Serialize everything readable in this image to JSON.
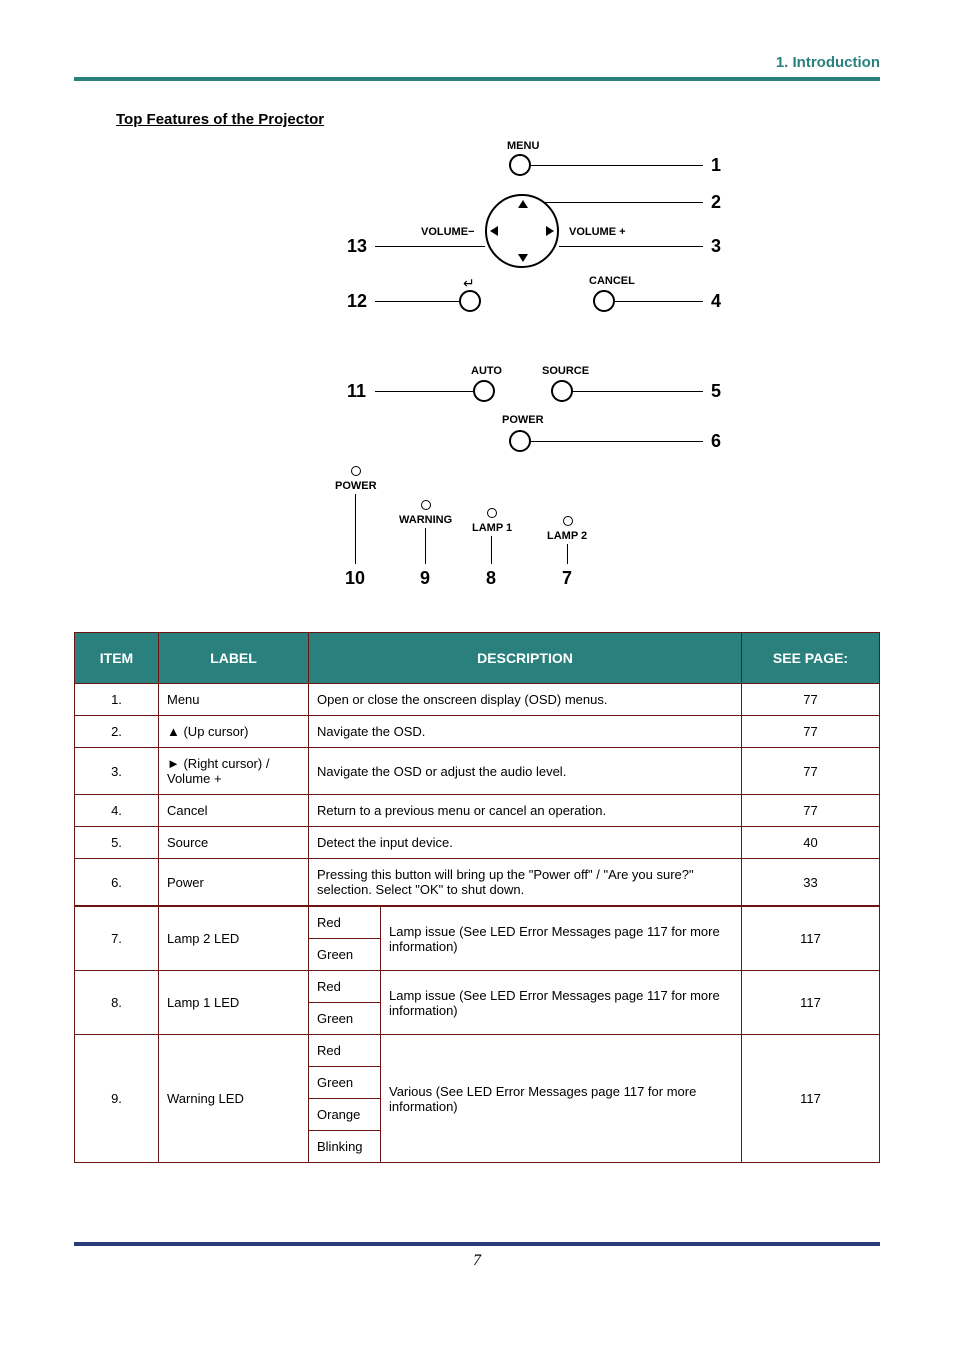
{
  "header": {
    "title": "1. Introduction"
  },
  "section_title": "Top Features of the Projector",
  "diagram": {
    "labels": {
      "menu": "MENU",
      "volume_minus": "VOLUME−",
      "volume_plus": "VOLUME +",
      "cancel": "CANCEL",
      "auto": "AUTO",
      "source": "SOURCE",
      "power_btn": "POWER",
      "power_led": "POWER",
      "warning": "WARNING",
      "lamp1": "LAMP 1",
      "lamp2": "LAMP 2"
    },
    "numbers": {
      "n1": "1",
      "n2": "2",
      "n3": "3",
      "n4": "4",
      "n5": "5",
      "n6": "6",
      "n7": "7",
      "n8": "8",
      "n9": "9",
      "n10": "10",
      "n11": "11",
      "n12": "12",
      "n13": "13"
    }
  },
  "table": {
    "headers": {
      "item": "ITEM",
      "label": "LABEL",
      "desc": "DESCRIPTION",
      "page": "SEE PAGE:"
    },
    "rows": [
      {
        "item": "1.",
        "label": "Menu",
        "desc": "Open or close the onscreen display (OSD) menus.",
        "page": "77"
      },
      {
        "item": "2.",
        "label": "▲ (Up cursor)",
        "desc": "Navigate the OSD.",
        "page": "77"
      },
      {
        "item": "3.",
        "label": "► (Right cursor) / Volume +",
        "desc": "Navigate the OSD or adjust the audio level.",
        "page": "77"
      },
      {
        "item": "4.",
        "label": "Cancel",
        "desc": "Return to a previous menu or cancel an operation.",
        "page": "77"
      },
      {
        "item": "5.",
        "label": "Source",
        "desc": "Detect the input device.",
        "page": "40"
      },
      {
        "item": "6.",
        "label": "Power",
        "desc": "Pressing this button will bring up the \"Power off\" / \"Are you sure?\" selection. Select \"OK\" to shut down.",
        "page": "33"
      },
      {
        "item": "7.",
        "label": "Lamp 2 LED",
        "sub1": "Red",
        "sub2": "Green",
        "subdesc": "Lamp issue (See LED Error Messages page 117 for more information)",
        "page": "117"
      },
      {
        "item": "8.",
        "label": "Lamp 1 LED",
        "sub1": "Red",
        "sub2": "Green",
        "subdesc": "Lamp issue (See LED Error Messages page 117 for more information)",
        "page": "117"
      },
      {
        "item": "9.",
        "label": "Warning LED",
        "sub1": "Red",
        "sub2": "Green",
        "sub3": "Orange",
        "sub4": "Blinking",
        "subdesc": "Various (See LED Error Messages page 117 for more information) ",
        "page": "117"
      }
    ]
  },
  "footer": {
    "page_number": "7"
  }
}
